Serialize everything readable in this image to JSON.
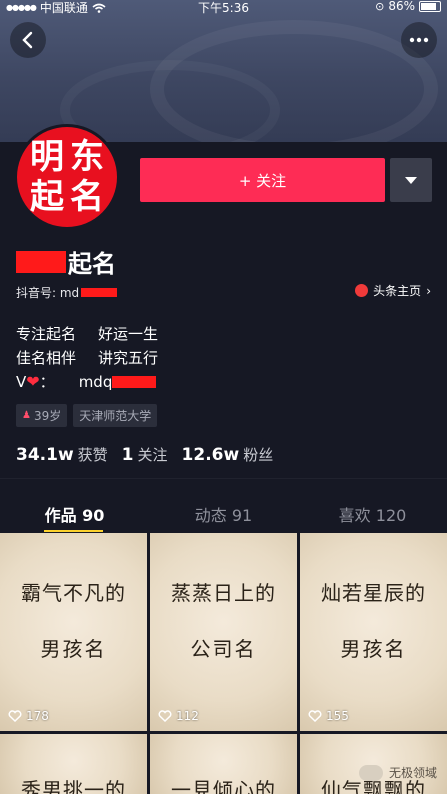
{
  "status_bar": {
    "carrier": "中国联通",
    "time": "下午5:36",
    "battery": "86%"
  },
  "profile": {
    "avatar_chars": [
      "明",
      "东",
      "起",
      "名"
    ],
    "follow_label": "+ 关注",
    "name_suffix": "起名",
    "id_label": "抖音号: md",
    "toutiao_label": "头条主页",
    "bio_lines": [
      [
        "专注起名",
        "好运一生"
      ],
      [
        "佳名相伴",
        "讲究五行"
      ]
    ],
    "contact_prefix": "V",
    "contact_colon": "：",
    "contact_value": "mdq",
    "tags": [
      "39岁",
      "天津师范大学"
    ]
  },
  "stats": [
    {
      "num": "34.1w",
      "label": "获赞"
    },
    {
      "num": "1",
      "label": "关注"
    },
    {
      "num": "12.6w",
      "label": "粉丝"
    }
  ],
  "tabs": [
    {
      "label": "作品 90",
      "active": true
    },
    {
      "label": "动态 91",
      "active": false
    },
    {
      "label": "喜欢 120",
      "active": false
    }
  ],
  "videos": [
    {
      "line1": "霸气不凡的",
      "line2": "男孩名",
      "likes": "178"
    },
    {
      "line1": "蒸蒸日上的",
      "line2": "公司名",
      "likes": "112"
    },
    {
      "line1": "灿若星辰的",
      "line2": "男孩名",
      "likes": "155"
    },
    {
      "line1": "秀男挑一的",
      "line2": "",
      "likes": ""
    },
    {
      "line1": "一見倾心的",
      "line2": "",
      "likes": ""
    },
    {
      "line1": "仙气飘飘的",
      "line2": "",
      "likes": ""
    }
  ],
  "watermark": "无极领域",
  "colors": {
    "background": "#161824",
    "follow_button": "#fe2c55",
    "tab_indicator": "#fbd12d",
    "avatar_red": "#e8101f"
  }
}
